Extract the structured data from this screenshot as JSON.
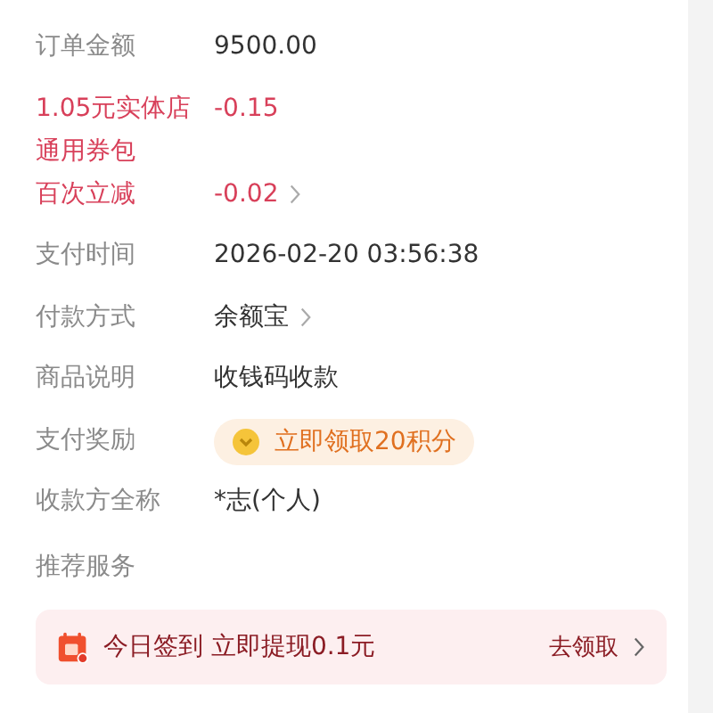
{
  "details": [
    {
      "kind": "plain",
      "label": "订单金额",
      "value": "9500.00",
      "chevron": false
    },
    {
      "kind": "discount",
      "label": "1.05元实体店通用券包",
      "value": "-0.15",
      "chevron": false
    },
    {
      "kind": "discount",
      "label": "百次立减",
      "value": "-0.02",
      "chevron": true
    },
    {
      "kind": "plain",
      "label": "支付时间",
      "value": "2026-02-20 03:56:38",
      "chevron": false
    },
    {
      "kind": "plain",
      "label": "付款方式",
      "value": "余额宝",
      "chevron": true
    },
    {
      "kind": "plain",
      "label": "商品说明",
      "value": "收钱码收款",
      "chevron": false
    },
    {
      "kind": "reward",
      "label": "支付奖励",
      "value": "立即领取20积分",
      "chevron": false
    },
    {
      "kind": "plain",
      "label": "收款方全称",
      "value": "*志(个人)",
      "chevron": false
    }
  ],
  "section_title": "推荐服务",
  "promo": {
    "text": "今日签到 立即提现0.1元",
    "action": "去领取"
  }
}
